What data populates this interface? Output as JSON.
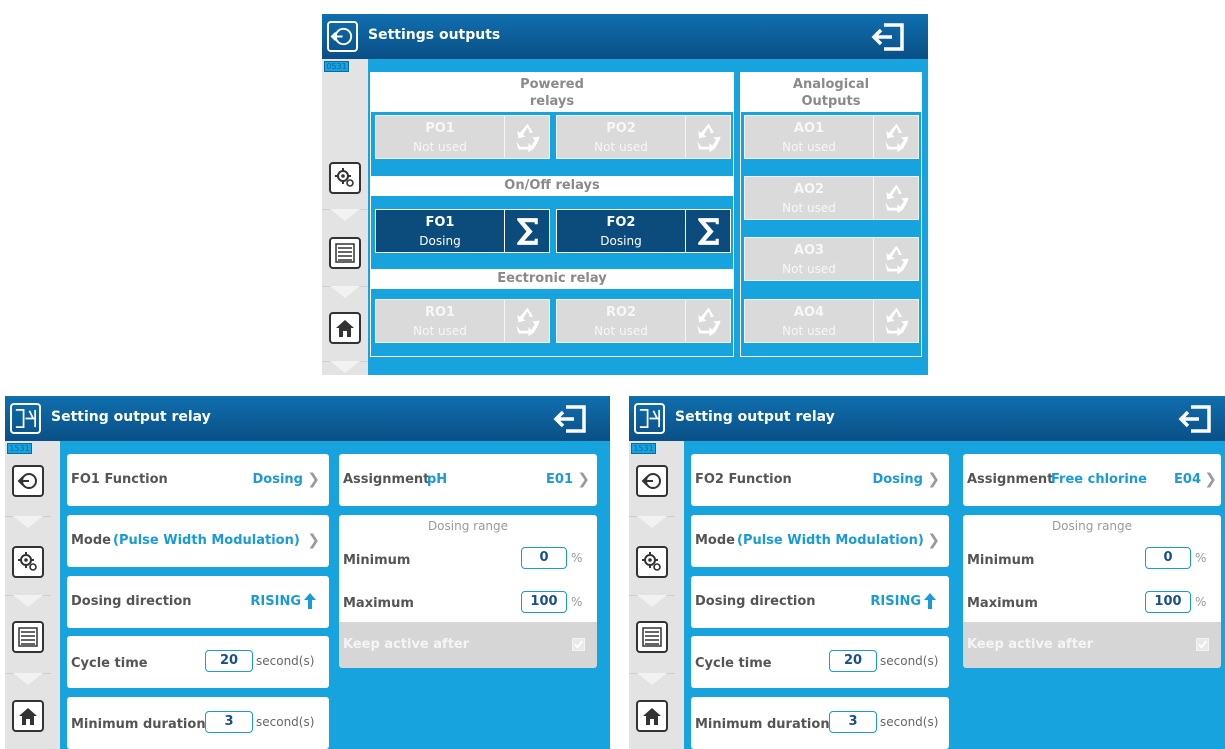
{
  "top": {
    "title": "Settings outputs",
    "tab_code": "0531",
    "powered_header": "Powered relays",
    "powered_line1": "Powered",
    "powered_line2": "relays",
    "onoff_header": "On/Off relays",
    "electronic_header": "Eectronic relay",
    "analog_line1": "Analogical",
    "analog_line2": "Outputs",
    "tiles": {
      "po1": {
        "name": "PO1",
        "status": "Not used"
      },
      "po2": {
        "name": "PO2",
        "status": "Not used"
      },
      "fo1": {
        "name": "FO1",
        "status": "Dosing"
      },
      "fo2": {
        "name": "FO2",
        "status": "Dosing"
      },
      "ro1": {
        "name": "RO1",
        "status": "Not used"
      },
      "ro2": {
        "name": "RO2",
        "status": "Not used"
      },
      "ao1": {
        "name": "AO1",
        "status": "Not used"
      },
      "ao2": {
        "name": "AO2",
        "status": "Not used"
      },
      "ao3": {
        "name": "AO3",
        "status": "Not used"
      },
      "ao4": {
        "name": "AO4",
        "status": "Not used"
      }
    },
    "icons": {
      "back": "back-circle-icon",
      "exit": "exit-icon",
      "tile_action_unused": "recycle-icon",
      "tile_action_dosing": "sigma-icon"
    }
  },
  "left": {
    "title": "Setting output relay",
    "tab_code": "1531",
    "function_label": "FO1 Function",
    "function_value": "Dosing",
    "assignment_label": "Assignment",
    "assignment_value": "pH",
    "assignment_code": "E01",
    "mode_label": "Mode",
    "mode_value": "(Pulse Width Modulation)",
    "direction_label": "Dosing direction",
    "direction_value": "RISING",
    "cycle_label": "Cycle time",
    "cycle_value": "20",
    "cycle_unit": "second(s)",
    "min_dur_label": "Minimum duration",
    "min_dur_value": "3",
    "min_dur_unit": "second(s)",
    "range_title": "Dosing range",
    "minimum_label": "Minimum",
    "minimum_value": "0",
    "maximum_label": "Maximum",
    "maximum_value": "100",
    "percent": "%",
    "keep_label": "Keep active after",
    "keep_checked": true
  },
  "right": {
    "title": "Setting output relay",
    "tab_code": "1531",
    "function_label": "FO2 Function",
    "function_value": "Dosing",
    "assignment_label": "Assignment",
    "assignment_value": "Free chlorine",
    "assignment_code": "E04",
    "mode_label": "Mode",
    "mode_value": "(Pulse Width Modulation)",
    "direction_label": "Dosing direction",
    "direction_value": "RISING",
    "cycle_label": "Cycle time",
    "cycle_value": "20",
    "cycle_unit": "second(s)",
    "min_dur_label": "Minimum duration",
    "min_dur_value": "3",
    "min_dur_unit": "second(s)",
    "range_title": "Dosing range",
    "minimum_label": "Minimum",
    "minimum_value": "0",
    "maximum_label": "Maximum",
    "maximum_value": "100",
    "percent": "%",
    "keep_label": "Keep active after",
    "keep_checked": true
  },
  "colors": {
    "screen_bg": "#17a3dd",
    "titlebar": "#0a4f86",
    "active_tile": "#0b4c7c",
    "value_blue": "#1b9ad8"
  }
}
